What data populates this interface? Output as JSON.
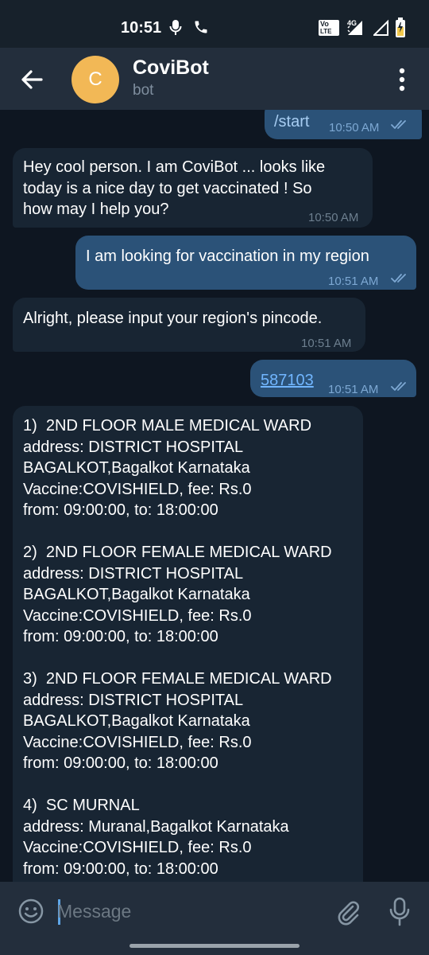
{
  "status_bar": {
    "time": "10:51",
    "network": "4G",
    "indicator_labels": [
      "Vo",
      "LTE"
    ],
    "icons": [
      "microphone-icon",
      "phone-icon",
      "volte-icon",
      "signal-icon",
      "battery-icon"
    ]
  },
  "header": {
    "avatar_letter": "C",
    "title": "CoviBot",
    "subtitle": "bot",
    "avatar_color": "#f2b856"
  },
  "messages": [
    {
      "direction": "outgoing",
      "text": "/start",
      "time": "10:50 AM",
      "status": "read"
    },
    {
      "direction": "incoming",
      "text": "Hey cool person. I am CoviBot ... looks like\ntoday is a nice day to get vaccinated ! So\nhow may I help you?",
      "time": "10:50 AM"
    },
    {
      "direction": "outgoing",
      "text": "I am looking for vaccination in my region",
      "time": "10:51 AM",
      "status": "read"
    },
    {
      "direction": "incoming",
      "text": "Alright, please input your region's pincode.",
      "time": "10:51 AM"
    },
    {
      "direction": "outgoing",
      "text": "587103",
      "time": "10:51 AM",
      "status": "read"
    },
    {
      "direction": "incoming",
      "text": "1)  2ND FLOOR MALE MEDICAL WARD\naddress: DISTRICT HOSPITAL\nBAGALKOT,Bagalkot Karnataka\nVaccine:COVISHIELD, fee: Rs.0\nfrom: 09:00:00, to: 18:00:00\n\n2)  2ND FLOOR FEMALE MEDICAL WARD\naddress: DISTRICT HOSPITAL\nBAGALKOT,Bagalkot Karnataka\nVaccine:COVISHIELD, fee: Rs.0\nfrom: 09:00:00, to: 18:00:00\n\n3)  2ND FLOOR FEMALE MEDICAL WARD\naddress: DISTRICT HOSPITAL\nBAGALKOT,Bagalkot Karnataka\nVaccine:COVISHIELD, fee: Rs.0\nfrom: 09:00:00, to: 18:00:00\n\n4)  SC MURNAL\naddress: Muranal,Bagalkot Karnataka\nVaccine:COVISHIELD, fee: Rs.0\nfrom: 09:00:00, to: 18:00:00"
    }
  ],
  "composer": {
    "placeholder": "Message"
  },
  "colors": {
    "background": "#0e1621",
    "header": "#232e3c",
    "incoming_bubble": "#182533",
    "outgoing_bubble": "#2b5278",
    "link": "#71b6ff",
    "read_ticks": "#7da8d3"
  }
}
